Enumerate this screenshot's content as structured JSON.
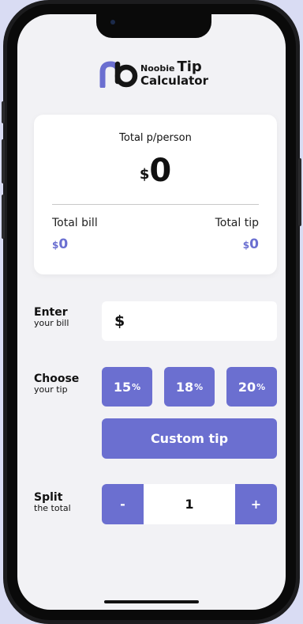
{
  "app": {
    "logo_small": "Noobie",
    "logo_big": "Tip",
    "logo_line2": "Calculator"
  },
  "summary": {
    "title": "Total p/person",
    "currency": "$",
    "per_person": "0",
    "total_bill_label": "Total bill",
    "total_bill_value": "0",
    "total_tip_label": "Total tip",
    "total_tip_value": "0"
  },
  "bill": {
    "label_main": "Enter",
    "label_sub": "your bill",
    "currency": "$",
    "value": "",
    "placeholder": ""
  },
  "tip": {
    "label_main": "Choose",
    "label_sub": "your tip",
    "options": [
      {
        "value": "15",
        "unit": "%"
      },
      {
        "value": "18",
        "unit": "%"
      },
      {
        "value": "20",
        "unit": "%"
      }
    ],
    "custom_label": "Custom tip"
  },
  "split": {
    "label_main": "Split",
    "label_sub": "the total",
    "minus": "-",
    "plus": "+",
    "count": "1"
  },
  "colors": {
    "accent": "#6b6fd0",
    "background": "#f2f2f5",
    "card": "#ffffff",
    "frame_bg": "#d9dcf3"
  },
  "icons": [
    "noobie-logo-icon"
  ]
}
